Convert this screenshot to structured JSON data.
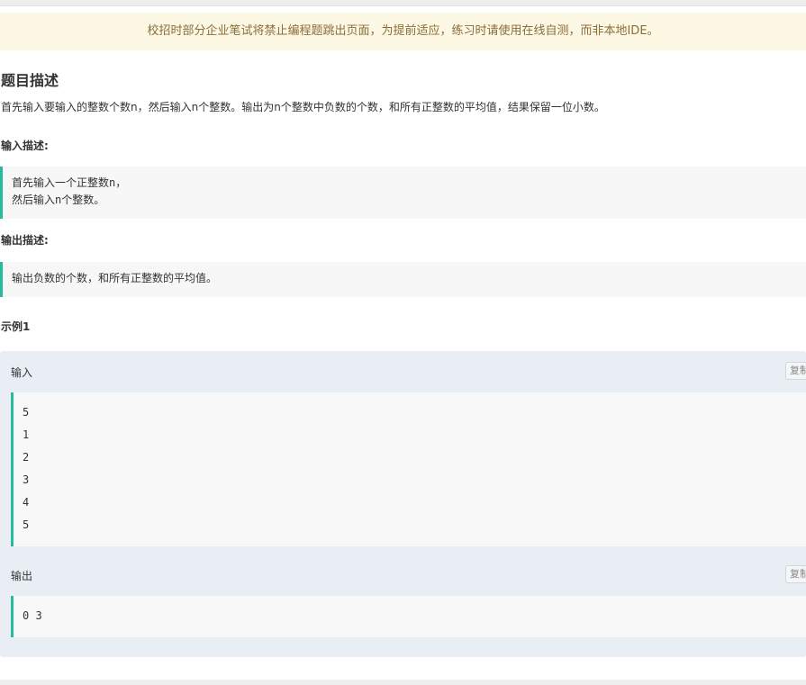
{
  "notice": "校招时部分企业笔试将禁止编程题跳出页面，为提前适应，练习时请使用在线自测，而非本地IDE。",
  "problem": {
    "title": "题目描述",
    "description": "首先输入要输入的整数个数n，然后输入n个整数。输出为n个整数中负数的个数，和所有正整数的平均值，结果保留一位小数。"
  },
  "input_section": {
    "label": "输入描述:",
    "lines": [
      "首先输入一个正整数n，",
      "然后输入n个整数。"
    ]
  },
  "output_section": {
    "label": "输出描述:",
    "lines": [
      "输出负数的个数，和所有正整数的平均值。"
    ]
  },
  "example": {
    "title": "示例1",
    "input_label": "输入",
    "input_lines": [
      "5",
      "1",
      "2",
      "3",
      "4",
      "5"
    ],
    "output_label": "输出",
    "output_lines": [
      "0 3"
    ],
    "copy_label": "复制"
  },
  "colors": {
    "accent": "#25bb9b",
    "notice_bg": "#fdf8e4",
    "notice_text": "#8a6d3b",
    "example_bg": "#e9eef5"
  }
}
